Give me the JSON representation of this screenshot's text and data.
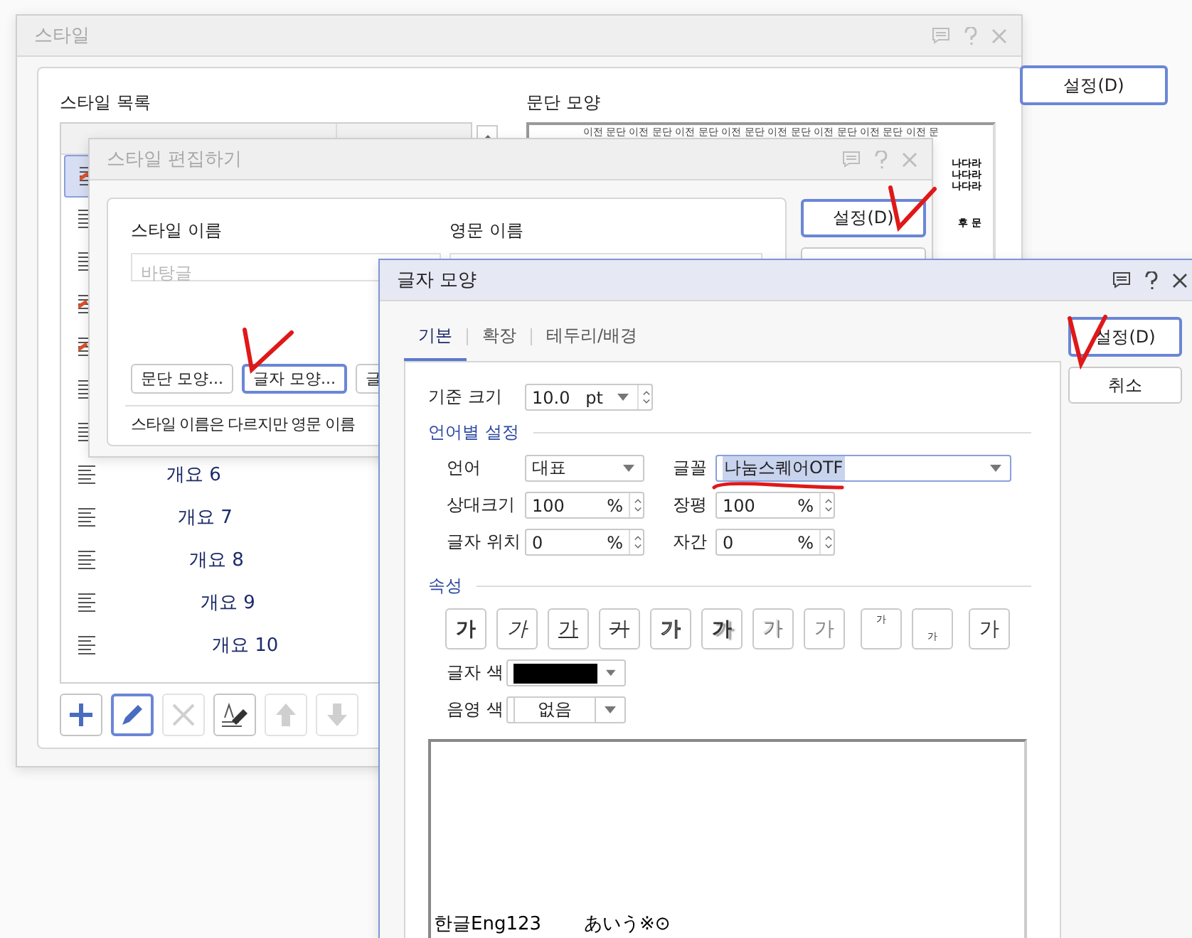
{
  "style_dialog": {
    "title": "스타일",
    "list_label": "스타일 목록",
    "rows": [
      {
        "kind": "char",
        "selected": true
      },
      {
        "kind": "para",
        "selected": false
      },
      {
        "kind": "para",
        "selected": false
      },
      {
        "kind": "char",
        "selected": false
      },
      {
        "kind": "char",
        "selected": false
      },
      {
        "kind": "para",
        "selected": false
      },
      {
        "kind": "para",
        "selected": false
      },
      {
        "kind": "para",
        "selected": false,
        "name": "개요 6"
      },
      {
        "kind": "para",
        "selected": false,
        "name": "개요 7"
      },
      {
        "kind": "para",
        "selected": false,
        "name": "개요 8"
      },
      {
        "kind": "para",
        "selected": false,
        "name": "개요 9"
      },
      {
        "kind": "para",
        "selected": false,
        "name": "개요 10"
      }
    ],
    "tools": [
      {
        "kind": "add",
        "disabled": false,
        "selected": false
      },
      {
        "kind": "edit",
        "disabled": false,
        "selected": true
      },
      {
        "kind": "delete",
        "disabled": true,
        "selected": false
      },
      {
        "kind": "pick",
        "disabled": false,
        "selected": false
      },
      {
        "kind": "up",
        "disabled": true,
        "selected": false
      },
      {
        "kind": "down",
        "disabled": true,
        "selected": false
      }
    ],
    "preview_label": "문단 모양",
    "preview_lines": [
      "이전 문단 이전 문단 이전 문단 이전 문단 이전 문단 이전 문단 이전 문단 이전 문",
      "나다라",
      "나다라",
      "나다라",
      "후 문"
    ],
    "button": "설정(D)"
  },
  "edit_dialog": {
    "title": "스타일 편집하기",
    "name_label": "스타일 이름",
    "name_placeholder": "바탕글",
    "english_label": "영문 이름",
    "buttons": [
      {
        "label": "문단 모양...",
        "focused": false
      },
      {
        "label": "글자 모양...",
        "focused": true
      },
      {
        "label": "글",
        "focused": false
      }
    ],
    "note": "스타일 이름은 다르지만 영문 이름",
    "button": "설정(D)"
  },
  "char_dialog": {
    "title": "글자 모양",
    "tabs": [
      {
        "label": "기본",
        "selected": true
      },
      {
        "label": "확장",
        "selected": false
      },
      {
        "label": "테두리/배경",
        "selected": false
      }
    ],
    "buttons": [
      "설정(D)",
      "취소"
    ],
    "base_size": {
      "label": "기준 크기",
      "value": "10.0",
      "unit": "pt"
    },
    "lang_section": "언어별 설정",
    "language": {
      "label": "언어",
      "value": "대표"
    },
    "font": {
      "label": "글꼴",
      "value": "나눔스퀘어OTF"
    },
    "fields": [
      {
        "label": "상대크기",
        "value": "100",
        "unit": "%"
      },
      {
        "label": "장평",
        "value": "100",
        "unit": "%"
      },
      {
        "label": "글자 위치",
        "value": "0",
        "unit": "%"
      },
      {
        "label": "자간",
        "value": "0",
        "unit": "%"
      }
    ],
    "attr_section": "속성",
    "attributes": [
      {
        "kind": "bold",
        "glyph": "가"
      },
      {
        "kind": "italic",
        "glyph": "가"
      },
      {
        "kind": "underline",
        "glyph": "가"
      },
      {
        "kind": "strike",
        "glyph": "가"
      },
      {
        "kind": "outline",
        "glyph": "가"
      },
      {
        "kind": "shadow",
        "glyph": "가"
      },
      {
        "kind": "emboss",
        "glyph": "가"
      },
      {
        "kind": "engrave",
        "glyph": "가"
      },
      {
        "kind": "superscript",
        "glyph": "가"
      },
      {
        "kind": "subscript",
        "glyph": "가"
      },
      {
        "kind": "normal",
        "glyph": "가"
      }
    ],
    "text_color": {
      "label": "글자 색",
      "color": "#000000"
    },
    "shade_color": {
      "label": "음영 색",
      "value": "없음"
    },
    "preview": [
      "한글Eng123",
      "あいう※⊙"
    ]
  }
}
